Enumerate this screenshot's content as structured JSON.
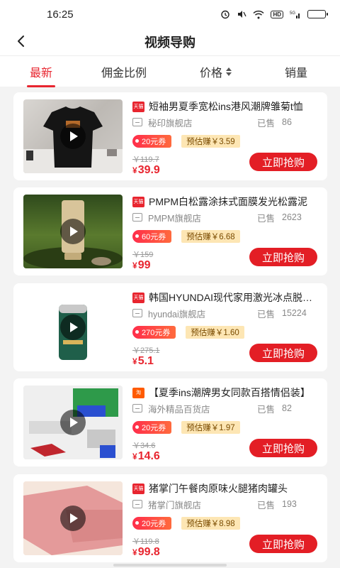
{
  "status_bar": {
    "time": "16:25",
    "network": "5G",
    "hd": "HD"
  },
  "header": {
    "title": "视频导购"
  },
  "tabs": [
    {
      "label": "最新",
      "active": true
    },
    {
      "label": "佣金比例",
      "active": false
    },
    {
      "label": "价格",
      "active": false,
      "sortable": true
    },
    {
      "label": "销量",
      "active": false
    }
  ],
  "colors": {
    "accent": "#e8252f",
    "coupon": "#ff3b47",
    "earn_bg": "#fde6b4"
  },
  "labels": {
    "sold": "已售",
    "buy": "立即抢购",
    "earn_prefix": "预估赚",
    "yen": "¥",
    "coupon_suffix": "元券"
  },
  "products": [
    {
      "platform": "tmall",
      "badge": "天猫",
      "title": "短袖男夏季宽松ins港风潮牌雏菊t恤",
      "shop": "秘印旗舰店",
      "sold": "86",
      "coupon": "20元券",
      "earn": "预估赚￥3.59",
      "original_price": "￥119.7",
      "price": "39.9",
      "thumb_icon": "black-tshirt-image"
    },
    {
      "platform": "tmall",
      "badge": "天猫",
      "title": "PMPM白松露涂抹式面膜发光松露泥",
      "shop": "PMPM旗舰店",
      "sold": "2623",
      "coupon": "60元券",
      "earn": "预估赚￥6.68",
      "original_price": "￥159",
      "price": "99",
      "thumb_icon": "face-mask-tube-image"
    },
    {
      "platform": "tmall",
      "badge": "天猫",
      "title": "韩国HYUNDAI现代家用激光冰点脱毛仪",
      "shop": "hyundai旗舰店",
      "sold": "15224",
      "coupon": "270元券",
      "earn": "预估赚￥1.60",
      "original_price": "￥275.1",
      "price": "5.1",
      "thumb_icon": "green-device-image"
    },
    {
      "platform": "taobao",
      "badge": "淘",
      "title": "【夏季ins潮牌男女同款百搭情侣装】",
      "shop": "海外精品百货店",
      "sold": "82",
      "coupon": "20元券",
      "earn": "预估赚￥1.97",
      "original_price": "￥34.6",
      "price": "14.6",
      "thumb_icon": "graffiti-print-image"
    },
    {
      "platform": "tmall",
      "badge": "天猫",
      "title": "猪掌门午餐肉原味火腿猪肉罐头",
      "shop": "猪掌门旗舰店",
      "sold": "193",
      "coupon": "20元券",
      "earn": "预估赚￥8.98",
      "original_price": "￥119.8",
      "price": "99.8",
      "thumb_icon": "luncheon-meat-image"
    }
  ]
}
